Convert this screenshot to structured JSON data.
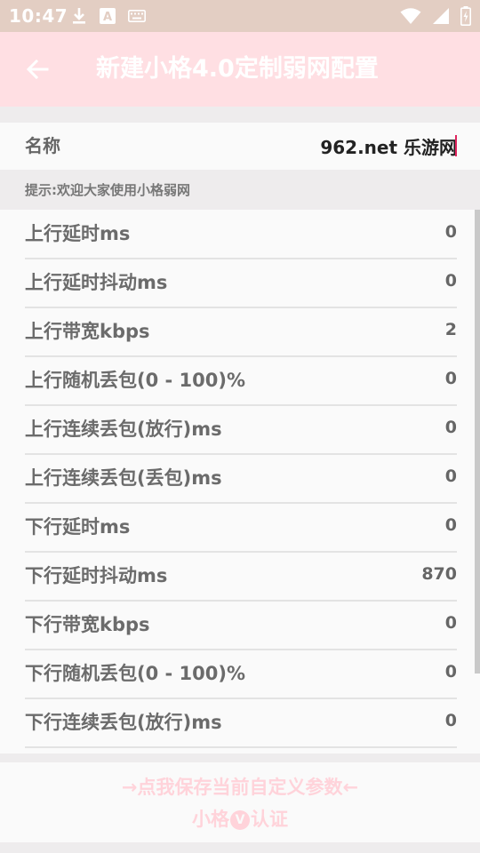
{
  "status_bar": {
    "time": "10:47",
    "left_icons": [
      "download-icon",
      "font-a-icon",
      "keyboard-icon"
    ],
    "right_icons": [
      "wifi-icon",
      "signal-icon",
      "battery-charging-icon"
    ],
    "font_icon_letter": "A"
  },
  "app_bar": {
    "title": "新建小格4.0定制弱网配置",
    "back_icon": "arrow-back-icon",
    "background": "#ffdfe3"
  },
  "name_field": {
    "label": "名称",
    "value": "962.net 乐游网"
  },
  "hint": "提示:欢迎大家使用小格弱网",
  "params": [
    {
      "label": "上行延时ms",
      "value": "0"
    },
    {
      "label": "上行延时抖动ms",
      "value": "0"
    },
    {
      "label": "上行带宽kbps",
      "value": "2"
    },
    {
      "label": "上行随机丢包(0 - 100)%",
      "value": "0"
    },
    {
      "label": "上行连续丢包(放行)ms",
      "value": "0"
    },
    {
      "label": "上行连续丢包(丢包)ms",
      "value": "0"
    },
    {
      "label": "下行延时ms",
      "value": "0"
    },
    {
      "label": "下行延时抖动ms",
      "value": "870"
    },
    {
      "label": "下行带宽kbps",
      "value": "0"
    },
    {
      "label": "下行随机丢包(0 - 100)%",
      "value": "0"
    },
    {
      "label": "下行连续丢包(放行)ms",
      "value": "0"
    }
  ],
  "save_button": {
    "line1": "→点我保存当前自定义参数←",
    "line2_prefix": "小格",
    "badge": "V",
    "line2_suffix": "认证",
    "color": "#ffd3da"
  }
}
